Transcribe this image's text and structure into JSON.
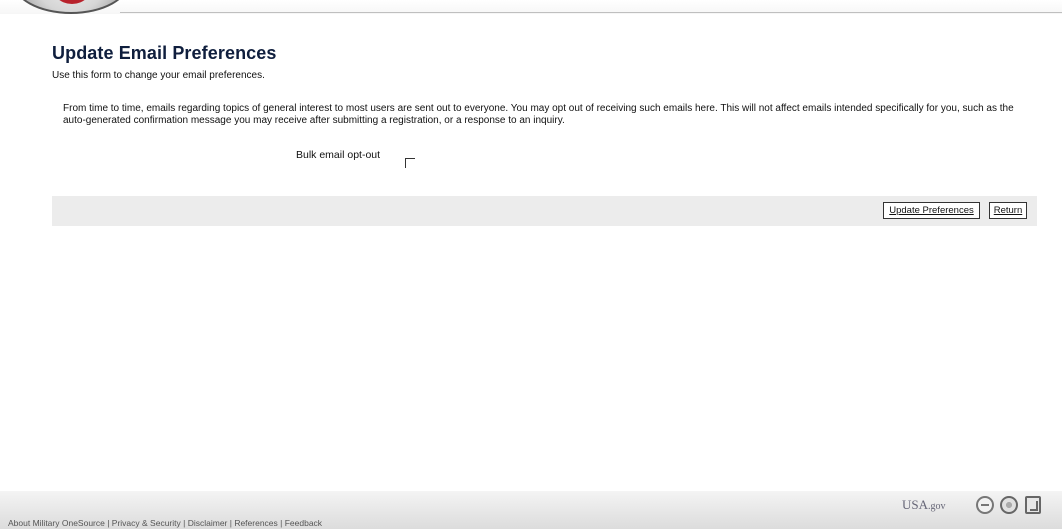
{
  "page": {
    "title": "Update Email Preferences",
    "subtitle": "Use this form to change your email preferences.",
    "description": "From time to time, emails regarding topics of general interest to most users are sent out to everyone. You may opt out of receiving such emails here. This will not affect emails intended specifically for you, such as the auto-generated confirmation message you may receive after submitting a registration, or a response to an inquiry."
  },
  "form": {
    "optout_label": "Bulk email opt-out",
    "optout_checked": false
  },
  "actions": {
    "update_label": "Update Preferences",
    "return_label": "Return"
  },
  "footer": {
    "links": [
      "About Military OneSource",
      "Privacy & Security",
      "Disclaimer",
      "References",
      "Feedback"
    ],
    "separator": " | ",
    "usa_gov_main": "USA",
    "usa_gov_suffix": ".gov"
  },
  "icons": {
    "footer_icon_1": "circle-minus-icon",
    "footer_icon_2": "seal-icon",
    "footer_icon_3": "accessibility-icon"
  },
  "colors": {
    "title": "#0f1e3d",
    "actions_bar": "#ececec"
  }
}
